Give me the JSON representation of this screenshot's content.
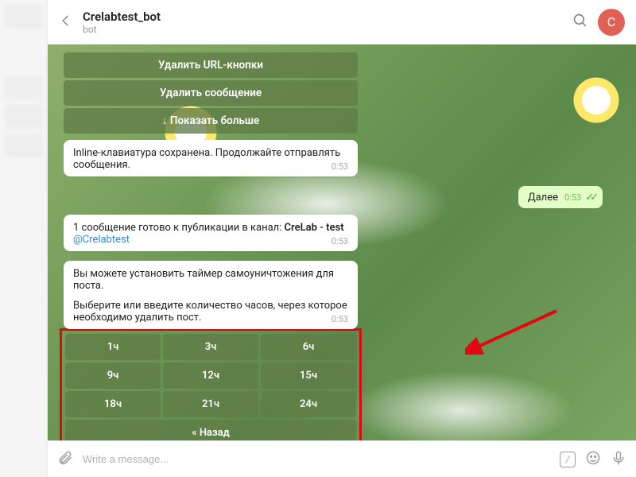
{
  "header": {
    "title": "Crelabtest_bot",
    "subtitle": "bot",
    "avatar_letter": "C"
  },
  "top_kb": {
    "r0": "Удалить URL-кнопки",
    "r1": "Удалить сообщение",
    "r2": "↓ Показать больше"
  },
  "msg_inline_saved": {
    "text": "Inline-клавиатура сохранена. Продолжайте отправлять сообщения.",
    "time": "0:53"
  },
  "msg_out": {
    "text": "Далее",
    "time": "0:53"
  },
  "msg_ready": {
    "prefix": "1 сообщение готово к публикации в канал: ",
    "channel_bold": "CreLab - test",
    "link": "@Crelabtest",
    "time": "0:53"
  },
  "msg_timer": {
    "line1": "Вы можете установить таймер самоуничтожения для поста.",
    "line2": "Выберите или введите количество часов, через которое необходимо удалить пост.",
    "time": "0:53"
  },
  "hours_kb": {
    "c0": "1ч",
    "c1": "3ч",
    "c2": "6ч",
    "c3": "9ч",
    "c4": "12ч",
    "c5": "15ч",
    "c6": "18ч",
    "c7": "21ч",
    "c8": "24ч",
    "back": "« Назад"
  },
  "composer": {
    "placeholder": "Write a message..."
  }
}
